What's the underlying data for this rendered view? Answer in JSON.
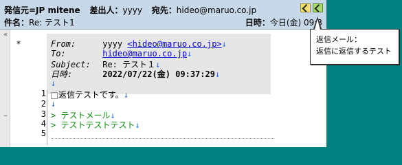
{
  "header": {
    "sender_label": "発信元=JP mitene",
    "from_label": "差出人：",
    "from_value": "yyyy",
    "to_label": "宛先：",
    "to_value": "hideo@maruo.co.jp",
    "subject_label": "件名：",
    "subject_value": "Re: テスト1",
    "date_label": "日時：",
    "date_value": "今日(金) 09:3"
  },
  "quote": {
    "from_label": "From:",
    "from_name": "yyyy",
    "from_email": "<hideo@maruo.co.jp>",
    "to_label": "To:",
    "to_email": "hideo@maruo.co.jp",
    "subject_label": "Subject:",
    "subject_value": "Re: テスト１",
    "date_label": "日時:",
    "date_value": "2022/07/22(金) 09:37:29",
    "arrow": "↓"
  },
  "lines": [
    {
      "num": "1",
      "text": "返信テストです。",
      "arrow": "↓"
    },
    {
      "num": "2",
      "text": "",
      "arrow": "↓"
    },
    {
      "num": "3",
      "text": "> テストメール",
      "arrow": "↓"
    },
    {
      "num": "4",
      "text": "> テストテストテスト",
      "arrow": "↓"
    },
    {
      "num": "5",
      "text": "",
      "arrow": ""
    }
  ],
  "gutter": {
    "marker": "«",
    "star": "*",
    "dash": "–"
  },
  "tooltip": {
    "title": "返信メール：",
    "text": "返信に返信するテスト"
  }
}
